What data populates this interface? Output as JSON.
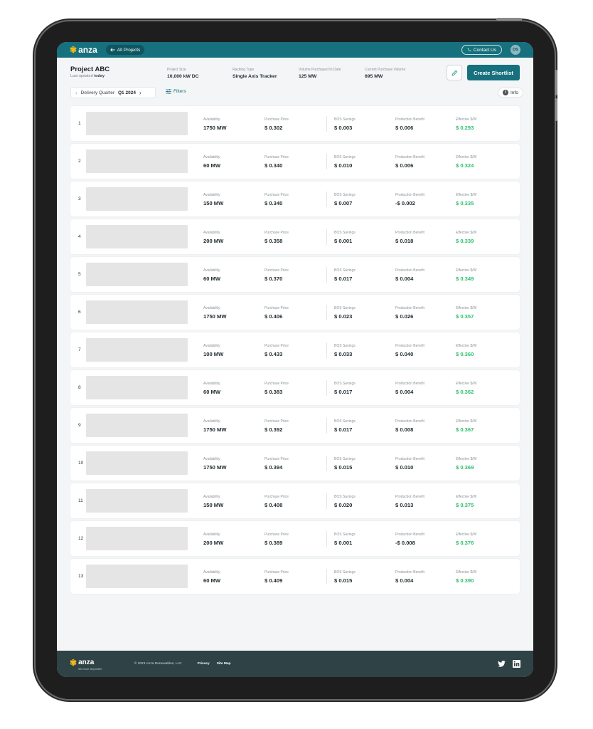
{
  "topbar": {
    "brand": "anza",
    "back_label": "All Projects",
    "contact_label": "Contact Us",
    "avatar_initials": "DS"
  },
  "project": {
    "title": "Project ABC",
    "updated_prefix": "Last updated",
    "updated_value": "today",
    "stats": [
      {
        "label": "Project Size",
        "value": "10,000 kW DC"
      },
      {
        "label": "Racking Type",
        "value": "Single Axis Tracker"
      },
      {
        "label": "Volume Purchased to Date",
        "value": "125 MW"
      },
      {
        "label": "Current Purchase Volume",
        "value": "695 MW"
      }
    ],
    "cta_label": "Create Shortlist"
  },
  "filters": {
    "quarter_label": "Delivery Quarter",
    "quarter_value": "Q1 2024",
    "filters_label": "Filters",
    "info_label": "Info"
  },
  "columns": {
    "availability": "Availability",
    "purchase_price": "Purchase Price",
    "bos_savings": "BOS Savings",
    "production_benefit": "Production Benefit",
    "effective": "Effective $/W"
  },
  "rows": [
    {
      "rank": "1",
      "availability": "1750 MW",
      "purchase_price": "$ 0.302",
      "bos_savings": "$ 0.003",
      "production_benefit": "$ 0.006",
      "effective": "$ 0.293"
    },
    {
      "rank": "2",
      "availability": "60 MW",
      "purchase_price": "$ 0.340",
      "bos_savings": "$ 0.010",
      "production_benefit": "$ 0.006",
      "effective": "$ 0.324"
    },
    {
      "rank": "3",
      "availability": "150 MW",
      "purchase_price": "$ 0.340",
      "bos_savings": "$ 0.007",
      "production_benefit": "-$ 0.002",
      "effective": "$ 0.335"
    },
    {
      "rank": "4",
      "availability": "200 MW",
      "purchase_price": "$ 0.358",
      "bos_savings": "$ 0.001",
      "production_benefit": "$ 0.018",
      "effective": "$ 0.339"
    },
    {
      "rank": "5",
      "availability": "60 MW",
      "purchase_price": "$ 0.370",
      "bos_savings": "$ 0.017",
      "production_benefit": "$ 0.004",
      "effective": "$ 0.349"
    },
    {
      "rank": "6",
      "availability": "1750 MW",
      "purchase_price": "$ 0.406",
      "bos_savings": "$ 0.023",
      "production_benefit": "$ 0.026",
      "effective": "$ 0.357"
    },
    {
      "rank": "7",
      "availability": "100 MW",
      "purchase_price": "$ 0.433",
      "bos_savings": "$ 0.033",
      "production_benefit": "$ 0.040",
      "effective": "$ 0.360"
    },
    {
      "rank": "8",
      "availability": "60 MW",
      "purchase_price": "$ 0.383",
      "bos_savings": "$ 0.017",
      "production_benefit": "$ 0.004",
      "effective": "$ 0.362"
    },
    {
      "rank": "9",
      "availability": "1750 MW",
      "purchase_price": "$ 0.392",
      "bos_savings": "$ 0.017",
      "production_benefit": "$ 0.008",
      "effective": "$ 0.367"
    },
    {
      "rank": "10",
      "availability": "1750 MW",
      "purchase_price": "$ 0.394",
      "bos_savings": "$ 0.015",
      "production_benefit": "$ 0.010",
      "effective": "$ 0.369"
    },
    {
      "rank": "11",
      "availability": "150 MW",
      "purchase_price": "$ 0.408",
      "bos_savings": "$ 0.020",
      "production_benefit": "$ 0.013",
      "effective": "$ 0.375"
    },
    {
      "rank": "12",
      "availability": "200 MW",
      "purchase_price": "$ 0.389",
      "bos_savings": "$ 0.001",
      "production_benefit": "-$ 0.008",
      "effective": "$ 0.376"
    },
    {
      "rank": "13",
      "availability": "60 MW",
      "purchase_price": "$ 0.409",
      "bos_savings": "$ 0.015",
      "production_benefit": "$ 0.004",
      "effective": "$ 0.390"
    }
  ],
  "footer": {
    "brand": "anza",
    "tagline": "See more. Buy better.",
    "copyright": "© 2023 Anza Renewables, LLC",
    "privacy": "Privacy",
    "sitemap": "Site Map"
  },
  "colors": {
    "primary": "#17707d",
    "accent_green": "#2fc06f",
    "footer": "#2f4245",
    "logo_yellow": "#f2b91b"
  },
  "icons": [
    "flower-logo-icon",
    "arrow-left-icon",
    "phone-icon",
    "pencil-icon",
    "chevron-left-icon",
    "chevron-right-icon",
    "sliders-icon",
    "info-icon",
    "twitter-icon",
    "linkedin-icon"
  ]
}
